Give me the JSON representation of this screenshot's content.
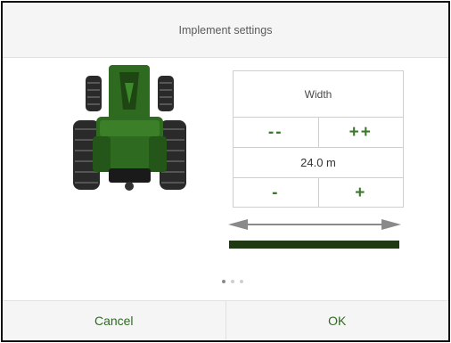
{
  "dialog": {
    "title": "Implement settings"
  },
  "panel": {
    "label": "Width",
    "big_decrease_label": "--",
    "big_increase_label": "++",
    "value": "24.0 m",
    "small_decrease_label": "-",
    "small_increase_label": "+"
  },
  "pager": {
    "page": 1,
    "page_count": 3
  },
  "footer": {
    "cancel_label": "Cancel",
    "ok_label": "OK"
  },
  "colors": {
    "accent": "#3c7a2b",
    "tractor_green": "#2e6a1f",
    "width_bar": "#1f3a12"
  },
  "icons": {
    "tractor": "tractor-rear-view-icon",
    "arrow": "double-arrow-horizontal-icon"
  }
}
